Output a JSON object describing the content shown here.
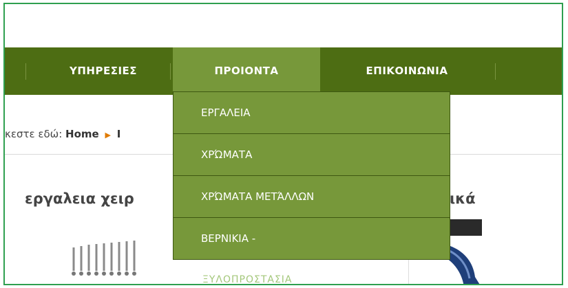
{
  "nav": {
    "items": [
      {
        "label": "ΥΠΗΡΕΣΙΕΣ"
      },
      {
        "label": "ΠΡΟΙΟΝΤΑ"
      },
      {
        "label": "ΕΠΙΚΟΙΝΩΝΙΑ"
      }
    ]
  },
  "dropdown": {
    "items": [
      {
        "label": "ΕΡΓΑΛΕΙΑ"
      },
      {
        "label": "ΧΡΏΜΑΤΑ"
      },
      {
        "label": "ΧΡΏΜΑΤΑ ΜΕΤΆΛΛΩΝ"
      },
      {
        "label": "ΒΕΡΝΙΚΙΑ -"
      }
    ]
  },
  "breadcrumb": {
    "prefix": "κεστε εδώ:",
    "home": "Home",
    "next": "Ι"
  },
  "section": {
    "title_left": "εργαλεια χειρ",
    "title_right": "ικά"
  },
  "products": {
    "ghost_label": "ΞΥΛΟΠΡΟΣΤΑΣΙΑ"
  },
  "colors": {
    "nav_bg": "#4d6d13",
    "active_bg": "#77983a",
    "frame_border": "#2e9f4f",
    "breadcrumb_arrow": "#e07b00"
  }
}
